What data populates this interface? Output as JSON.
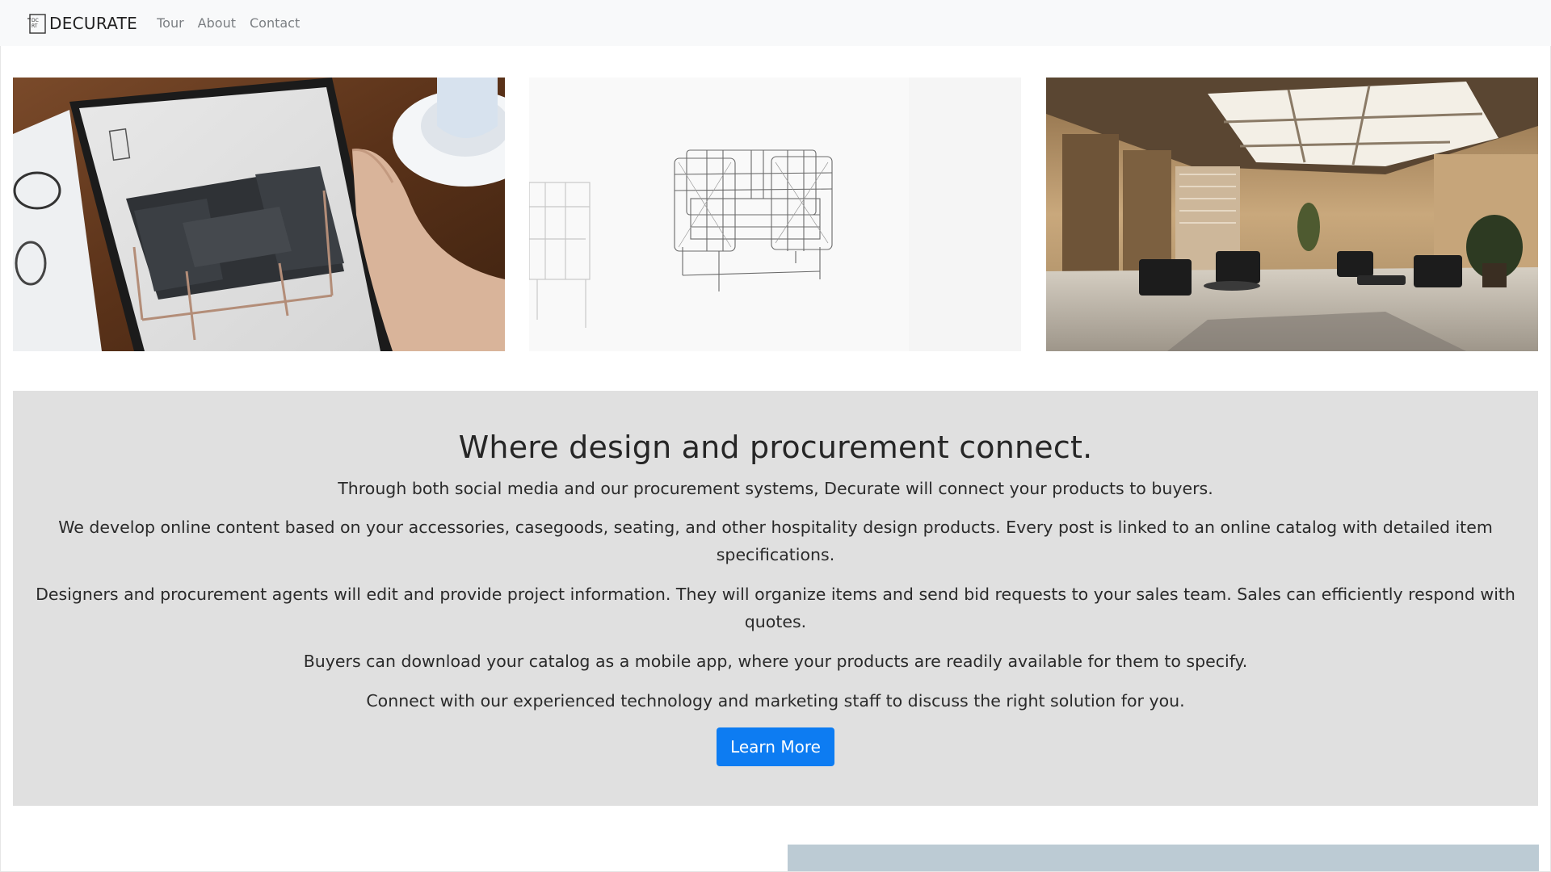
{
  "navbar": {
    "brand": "DECURATE",
    "links": [
      "Tour",
      "About",
      "Contact"
    ]
  },
  "gallery": {
    "images": [
      {
        "icon": "tablet-ar-armchair-photo",
        "logo_text": "DECURATE"
      },
      {
        "icon": "armchair-wireframe-render"
      },
      {
        "icon": "hotel-lobby-render"
      }
    ]
  },
  "hero": {
    "headline": "Where design and procurement connect.",
    "paragraphs": [
      "Through both social media and our procurement systems, Decurate will connect your products to buyers.",
      "We develop online content based on your accessories, casegoods, seating, and other hospitality design products. Every post is linked to an online catalog with detailed item specifications.",
      "Designers and procurement agents will edit and provide project information. They will organize items and send bid requests to your sales team. Sales can efficiently respond with quotes.",
      "Buyers can download your catalog as a mobile app, where your products are readily available for them to specify.",
      "Connect with our experienced technology and marketing staff to discuss the right solution for you."
    ],
    "cta_label": "Learn More"
  },
  "colors": {
    "navbar_bg": "#f8f9fa",
    "jumbotron_bg": "#e0e0e0",
    "cta_bg": "#0d7cf2",
    "nav_link": "#7a7e82"
  }
}
